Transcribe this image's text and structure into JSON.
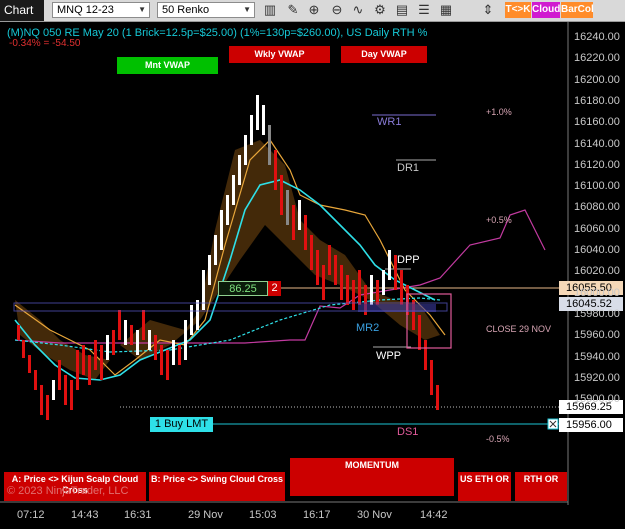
{
  "toolbar": {
    "chart_label": "Chart",
    "instrument": "MNQ 12-23",
    "bar_type": "50 Renko",
    "icons": [
      "bar-style-icon",
      "draw-icon",
      "zoom-in-icon",
      "zoom-out-icon",
      "indicators-icon",
      "strategies-icon",
      "templates-icon",
      "properties-icon",
      "data-box-icon",
      "chart-trader-icon"
    ],
    "buttons": [
      {
        "label": "T<>K",
        "color": "#ff8c2a"
      },
      {
        "label": "Cloud",
        "color": "#d01bd0"
      },
      {
        "label": "BarCol",
        "color": "#ff8c2a"
      }
    ]
  },
  "chart": {
    "title": "(M)NQ 050 RE May 20 (1 Brick=12.5p=$25.00) (1%=130p=$260.00), US Daily RTH %",
    "change_text": "-0.34% = -54.50",
    "copyright": "© 2023 NinjaTrader, LLC",
    "vwap_buttons": [
      {
        "label": "Mnt VWAP",
        "color": "#00c000"
      },
      {
        "label": "Wkly VWAP",
        "color": "#cc0000"
      },
      {
        "label": "Day VWAP",
        "color": "#cc0000"
      }
    ],
    "pivots": [
      {
        "label": "WR1",
        "color": "#8a7cd8"
      },
      {
        "label": "DR1",
        "color": "#c8c8c8"
      },
      {
        "label": "DPP",
        "color": "#ffffff"
      },
      {
        "label": "MR2",
        "color": "#3aa0e0"
      },
      {
        "label": "WPP",
        "color": "#ffffff"
      },
      {
        "label": "DS1",
        "color": "#e05a9a"
      }
    ],
    "pct_labels": [
      "+1.0%",
      "+0.5%",
      "CLOSE 29 NOV",
      "-0.5%"
    ],
    "position_box": {
      "value": "86.25",
      "qty": "2"
    },
    "order_label": "1 Buy LMT",
    "price_tags": [
      {
        "value": "16055.50",
        "bg": "#f5d8b8"
      },
      {
        "value": "16045.52",
        "bg": "#d8dde8"
      },
      {
        "value": "15969.25",
        "bg": "#ffffff"
      },
      {
        "value": "15956.00",
        "bg": "#ffffff"
      }
    ],
    "bottom_buttons": [
      {
        "label": "A: Price <> Kijun Scalp Cloud Cross"
      },
      {
        "label": "B: Price <> Swing Cloud Cross"
      },
      {
        "label": "MOMENTUM"
      },
      {
        "label": "US ETH OR"
      },
      {
        "label": "RTH OR"
      }
    ]
  },
  "chart_data": {
    "type": "renko",
    "y_ticks": [
      "16240.00",
      "16220.00",
      "16200.00",
      "16180.00",
      "16160.00",
      "16140.00",
      "16120.00",
      "16100.00",
      "16080.00",
      "16060.00",
      "16040.00",
      "16020.00",
      "16000.00",
      "15980.00",
      "15960.00",
      "15940.00",
      "15920.00",
      "15900.00"
    ],
    "y_range": [
      15900,
      16240
    ],
    "x_ticks": [
      "07:12",
      "14:43",
      "16:31",
      "29 Nov",
      "15:03",
      "16:17",
      "30 Nov",
      "14:42"
    ],
    "last_price": 15969.25,
    "limit_order_price": 15956.0
  }
}
